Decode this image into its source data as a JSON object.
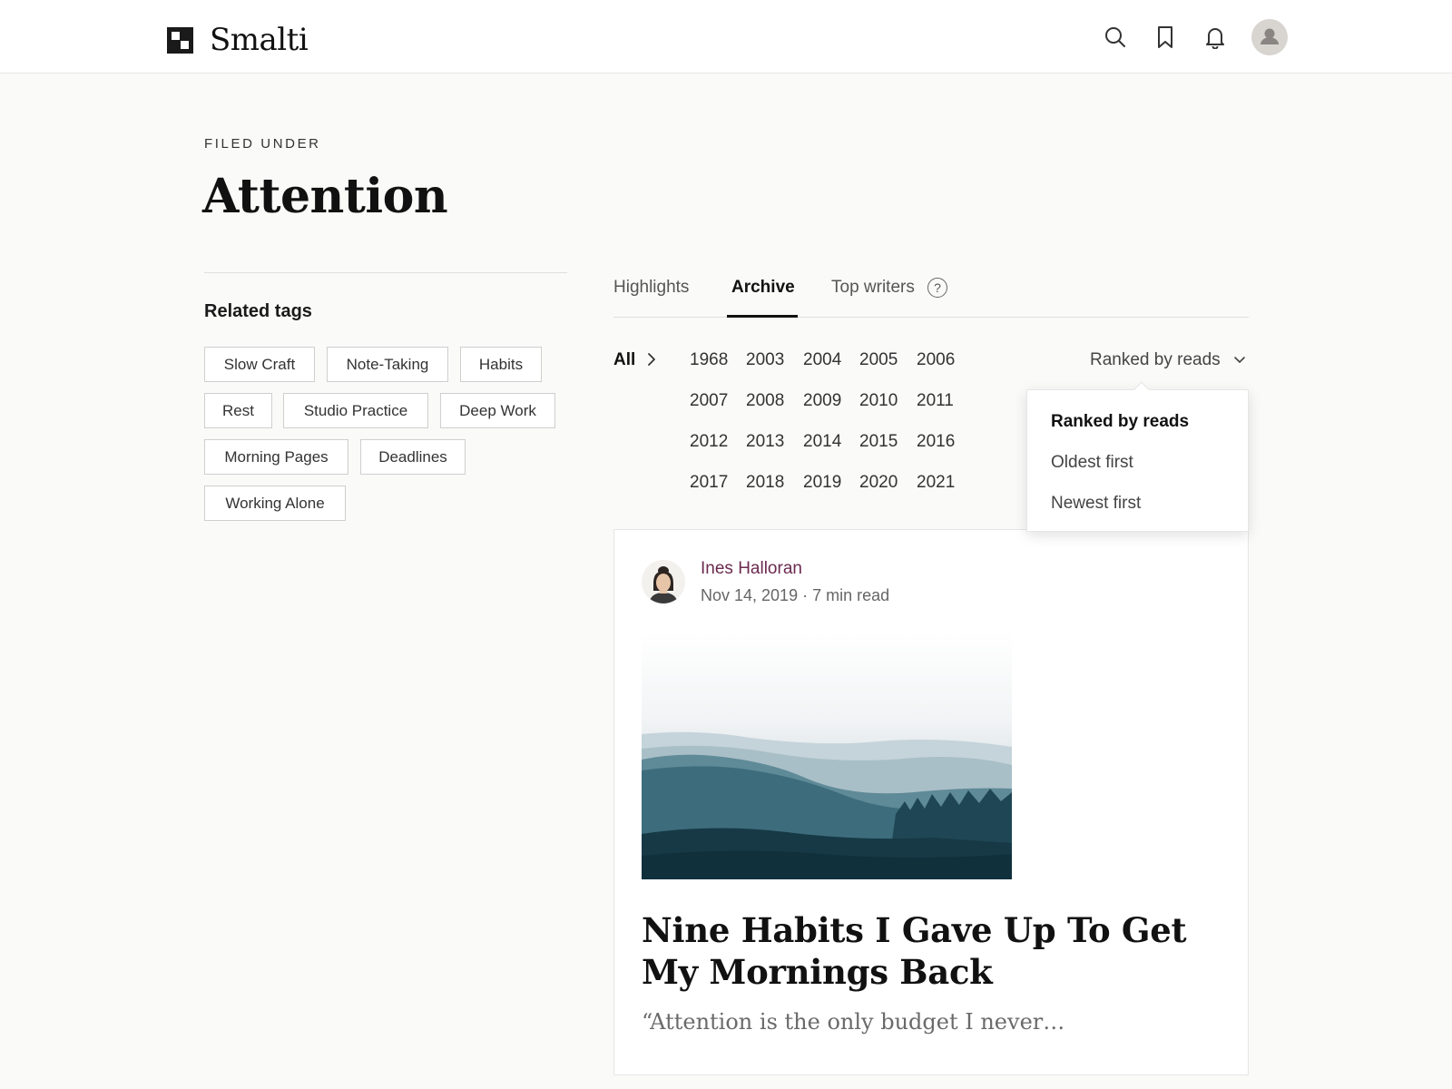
{
  "app": {
    "name": "Smalti"
  },
  "header": {
    "icons": [
      "search-icon",
      "bookmark-icon",
      "bell-icon",
      "avatar"
    ]
  },
  "page": {
    "kicker": "FILED UNDER",
    "title": "Attention"
  },
  "sidebar": {
    "related_title": "Related tags",
    "tags": [
      "Slow Craft",
      "Note-Taking",
      "Habits",
      "Rest",
      "Studio Practice",
      "Deep Work",
      "Morning Pages",
      "Deadlines",
      "Working Alone"
    ]
  },
  "tabs": {
    "items": [
      "Highlights",
      "Archive",
      "Top writers"
    ],
    "active": "Archive",
    "help_glyph": "?"
  },
  "filter": {
    "all_label": "All",
    "years": [
      "1968",
      "2003",
      "2004",
      "2005",
      "2006",
      "2007",
      "2008",
      "2009",
      "2010",
      "2011",
      "2012",
      "2013",
      "2014",
      "2015",
      "2016",
      "2017",
      "2018",
      "2019",
      "2020",
      "2021"
    ]
  },
  "sort": {
    "label": "Ranked by reads",
    "options": [
      "Ranked by reads",
      "Oldest first",
      "Newest first"
    ],
    "selected": "Ranked by reads"
  },
  "article": {
    "author": "Ines Halloran",
    "meta": "Nov 14, 2019 · 7 min read",
    "title": "Nine Habits I Gave Up To Get My Mornings Back",
    "excerpt": "“Attention is the only budget I never…"
  },
  "colors": {
    "author_link": "#6b2a4f",
    "background": "#fafaf9"
  }
}
